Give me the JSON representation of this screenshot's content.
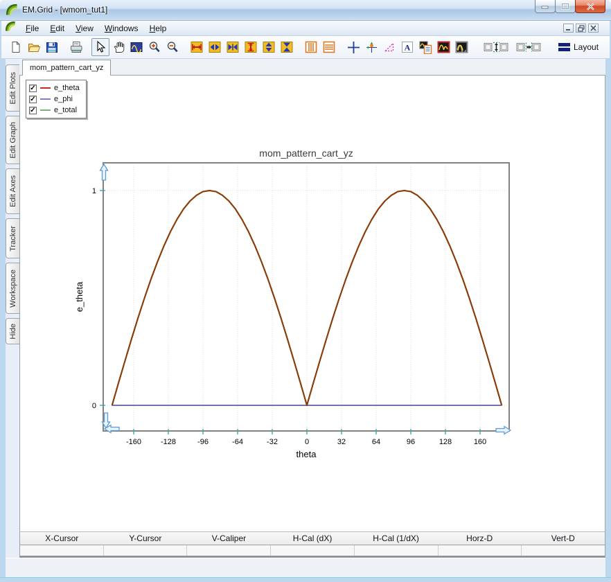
{
  "window": {
    "title": "EM.Grid - [wmom_tut1]",
    "controls": [
      "minimize-icon",
      "maximize-icon",
      "close-icon"
    ],
    "mdi_controls": [
      "mdi-minimize-icon",
      "mdi-restore-icon",
      "mdi-close-icon"
    ],
    "app_logo": "emgrid-leaf-logo-icon"
  },
  "menubar": {
    "items": [
      "File",
      "Edit",
      "View",
      "Windows",
      "Help"
    ]
  },
  "toolbar": {
    "icons": [
      "new-document",
      "open-file",
      "save-file",
      "print",
      "select-tool",
      "pan-tool",
      "zoom-window",
      "zoom-in",
      "zoom-out",
      "expand-horizontal",
      "arrows-horizontal",
      "compress-horizontal",
      "expand-vertical",
      "arrows-vertical",
      "compress-vertical",
      "vertical-gridlines",
      "horizontal-gridlines",
      "crosshair-cursor",
      "tracker",
      "caliper-triangle",
      "add-text",
      "plot-legend",
      "edit-plot",
      "edit-graphs",
      "link-vertical",
      "link-horizontal",
      "layout"
    ],
    "layout_label": "Layout"
  },
  "sidebar": {
    "tabs": [
      "Edit Plots",
      "Edit Graph",
      "Edit Axes",
      "Tracker",
      "Workspace",
      "Hide"
    ]
  },
  "document_tab": "mom_pattern_cart_yz",
  "legend": {
    "items": [
      {
        "label": "e_theta",
        "checked": true,
        "check": "✓",
        "swatch_color": "#c42a24"
      },
      {
        "label": "e_phi",
        "checked": true,
        "check": "✓",
        "swatch_color": "#7e7ec2"
      },
      {
        "label": "e_total",
        "checked": true,
        "check": "✓",
        "swatch_color": "#7fae7f"
      }
    ]
  },
  "cursor_table": {
    "headers": [
      "X-Cursor",
      "Y-Cursor",
      "V-Caliper",
      "H-Cal (dX)",
      "H-Cal (1/dX)",
      "Horz-D",
      "Vert-D"
    ],
    "row": [
      "",
      "",
      "",
      "",
      "",
      "",
      ""
    ]
  },
  "chart_data": {
    "type": "line",
    "title": "mom_pattern_cart_yz",
    "xlabel": "theta",
    "ylabel": "e_theta",
    "xlim": [
      -188,
      187
    ],
    "ylim": [
      -0.12,
      1.13
    ],
    "x_ticks": [
      -160,
      -128,
      -96,
      -64,
      -32,
      0,
      32,
      64,
      96,
      128,
      160
    ],
    "y_ticks": [
      0,
      1
    ],
    "grid": true,
    "legend_position": "top-left",
    "x": [
      -180,
      -174,
      -168,
      -162,
      -156,
      -150,
      -144,
      -138,
      -132,
      -126,
      -120,
      -114,
      -108,
      -102,
      -96,
      -90,
      -84,
      -78,
      -72,
      -66,
      -60,
      -54,
      -48,
      -42,
      -36,
      -30,
      -24,
      -18,
      -12,
      -6,
      0,
      6,
      12,
      18,
      24,
      30,
      36,
      42,
      48,
      54,
      60,
      66,
      72,
      78,
      84,
      90,
      96,
      102,
      108,
      114,
      120,
      126,
      132,
      138,
      144,
      150,
      156,
      162,
      168,
      174,
      180
    ],
    "series": [
      {
        "name": "e_phi",
        "plot_color": "#7373ad",
        "values": [
          0,
          0,
          0,
          0,
          0,
          0,
          0,
          0,
          0,
          0,
          0,
          0,
          0,
          0,
          0,
          0,
          0,
          0,
          0,
          0,
          0,
          0,
          0,
          0,
          0,
          0,
          0,
          0,
          0,
          0,
          0,
          0,
          0,
          0,
          0,
          0,
          0,
          0,
          0,
          0,
          0,
          0,
          0,
          0,
          0,
          0,
          0,
          0,
          0,
          0,
          0,
          0,
          0,
          0,
          0,
          0,
          0,
          0,
          0,
          0,
          0
        ]
      },
      {
        "name": "e_total",
        "plot_color": "#8a3c08",
        "values": [
          0,
          0.105,
          0.208,
          0.309,
          0.407,
          0.5,
          0.588,
          0.669,
          0.743,
          0.809,
          0.866,
          0.914,
          0.951,
          0.978,
          0.995,
          1,
          0.995,
          0.978,
          0.951,
          0.914,
          0.866,
          0.809,
          0.743,
          0.669,
          0.588,
          0.5,
          0.407,
          0.309,
          0.208,
          0.105,
          0,
          0.105,
          0.208,
          0.309,
          0.407,
          0.5,
          0.588,
          0.669,
          0.743,
          0.809,
          0.866,
          0.914,
          0.951,
          0.978,
          0.995,
          1,
          0.995,
          0.978,
          0.951,
          0.914,
          0.866,
          0.809,
          0.743,
          0.669,
          0.588,
          0.5,
          0.407,
          0.309,
          0.208,
          0.105,
          0
        ]
      },
      {
        "name": "e_theta",
        "plot_color": "#8a3c08",
        "values": [
          0,
          0.105,
          0.208,
          0.309,
          0.407,
          0.5,
          0.588,
          0.669,
          0.743,
          0.809,
          0.866,
          0.914,
          0.951,
          0.978,
          0.995,
          1,
          0.995,
          0.978,
          0.951,
          0.914,
          0.866,
          0.809,
          0.743,
          0.669,
          0.588,
          0.5,
          0.407,
          0.309,
          0.208,
          0.105,
          0,
          0.105,
          0.208,
          0.309,
          0.407,
          0.5,
          0.588,
          0.669,
          0.743,
          0.809,
          0.866,
          0.914,
          0.951,
          0.978,
          0.995,
          1,
          0.995,
          0.978,
          0.951,
          0.914,
          0.866,
          0.809,
          0.743,
          0.669,
          0.588,
          0.5,
          0.407,
          0.309,
          0.208,
          0.105,
          0
        ]
      }
    ]
  }
}
